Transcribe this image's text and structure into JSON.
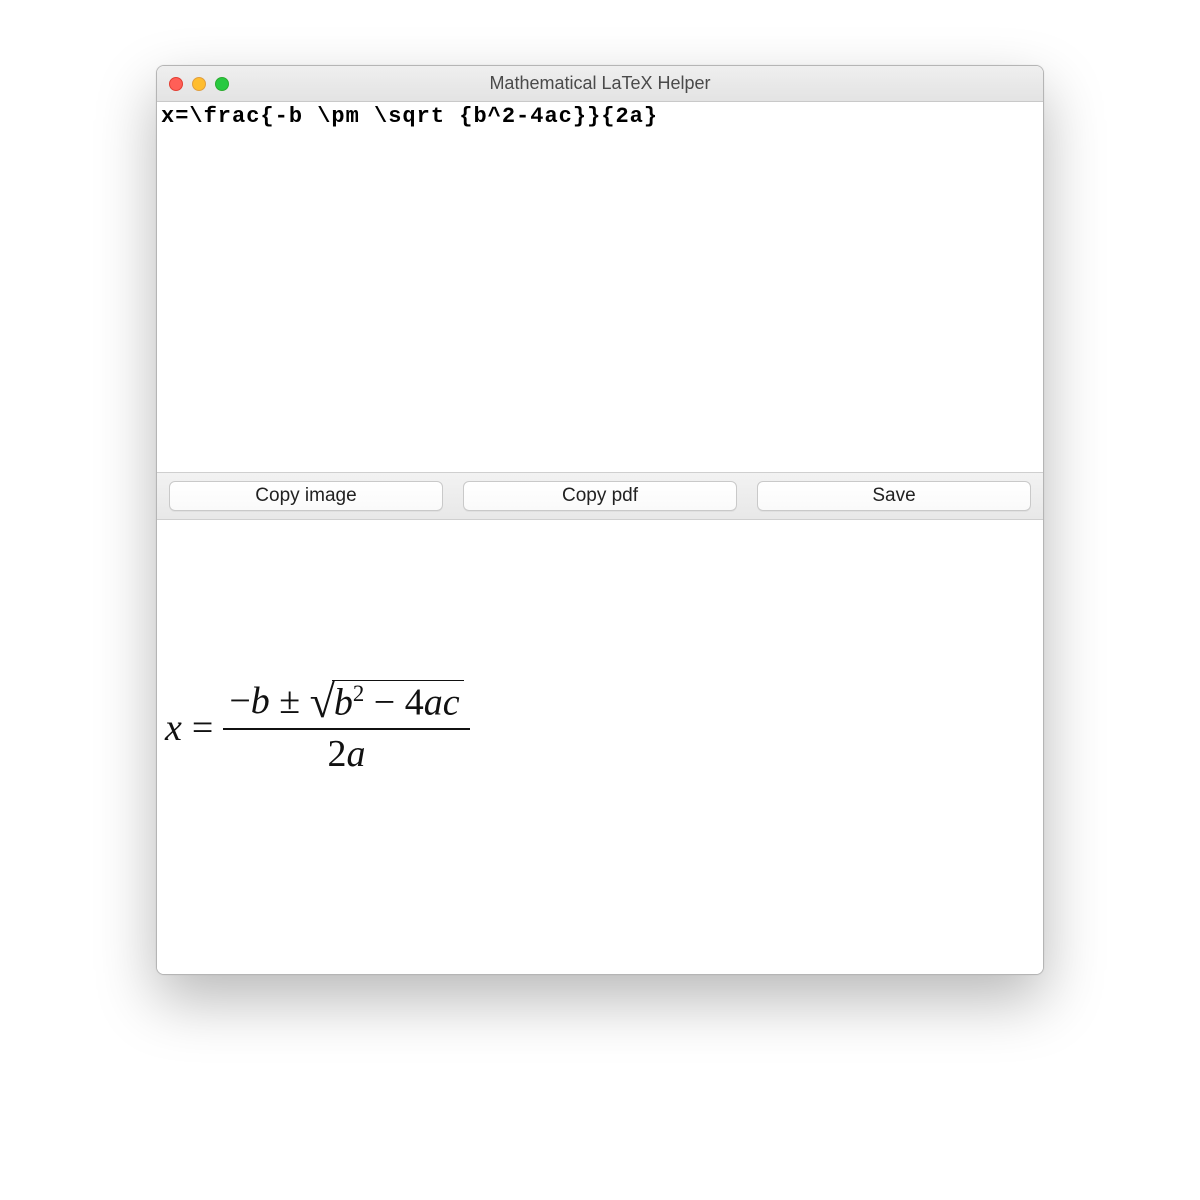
{
  "window": {
    "title": "Mathematical LaTeX Helper"
  },
  "editor": {
    "value": "x=\\frac{-b \\pm \\sqrt {b^2-4ac}}{2a}"
  },
  "toolbar": {
    "copy_image_label": "Copy image",
    "copy_pdf_label": "Copy pdf",
    "save_label": "Save"
  },
  "preview": {
    "lhs_var": "x",
    "equals": "=",
    "numerator_minus": "−",
    "numerator_b": "b",
    "pm": "±",
    "radicand_b": "b",
    "radicand_exp": "2",
    "radicand_minus": "−",
    "radicand_4": "4",
    "radicand_a": "a",
    "radicand_c": "c",
    "denominator_2": "2",
    "denominator_a": "a"
  }
}
